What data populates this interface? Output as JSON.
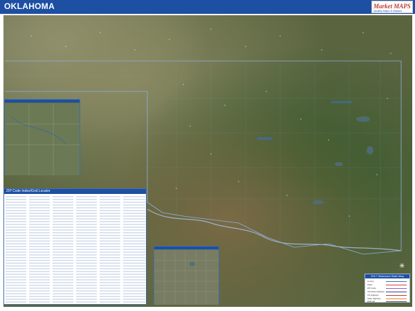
{
  "header": {
    "title": "OKLAHOMA",
    "logo_text": "Market MAPS",
    "logo_tagline": "Quality Maps & Atlases"
  },
  "zip_index": {
    "title": "ZIP Code Index/Grid Locator"
  },
  "legend": {
    "title": "2017 Oklahoma State Map",
    "items": [
      {
        "label": "County",
        "color": "#3e6fb3"
      },
      {
        "label": "State",
        "color": "#d33b3b"
      },
      {
        "label": "ZIP Code",
        "color": "#9b59b6"
      },
      {
        "label": "Interstate Highway",
        "color": "#1d4fa3"
      },
      {
        "label": "US Highway",
        "color": "#c0392b"
      },
      {
        "label": "State Highway",
        "color": "#e67e22"
      },
      {
        "label": "Railroad",
        "color": "#555555"
      }
    ]
  },
  "colors": {
    "header_bar": "#1d4fa3",
    "satellite_base": "#55613a",
    "boundary_line": "#8fb0e0"
  },
  "icons": {
    "compass": "compass-rose-icon"
  }
}
